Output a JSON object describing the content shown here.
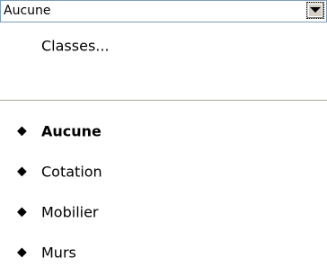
{
  "combo": {
    "value": "Aucune",
    "button_icon": "chevron-down-icon"
  },
  "menu": {
    "classes_label": "Classes...",
    "bullet_glyph": "◆",
    "items": [
      {
        "label": "Aucune",
        "checked": true
      },
      {
        "label": "Cotation",
        "checked": false
      },
      {
        "label": "Mobilier",
        "checked": false
      },
      {
        "label": "Murs",
        "checked": false
      }
    ]
  },
  "colors": {
    "border": "#7f9db9",
    "button_face": "#d4d0c8",
    "separator": "#aca899"
  }
}
